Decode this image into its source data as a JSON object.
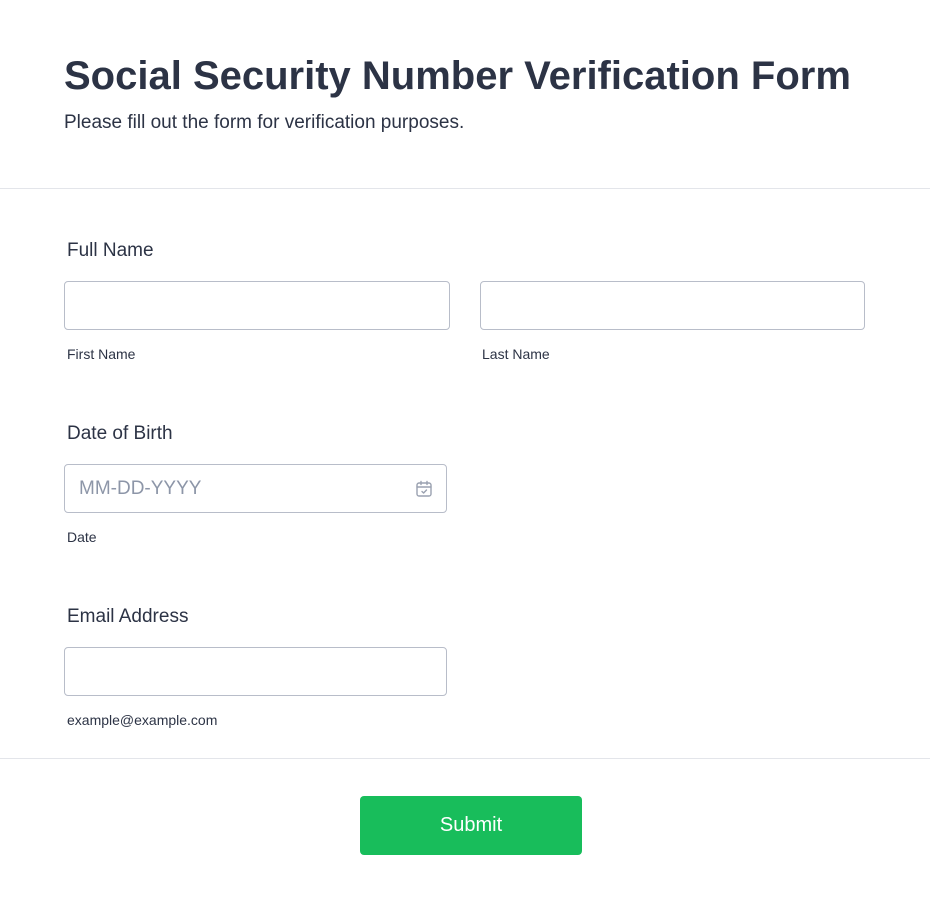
{
  "header": {
    "title": "Social Security Number Verification Form",
    "subtitle": "Please fill out the form for verification purposes."
  },
  "full_name": {
    "label": "Full Name",
    "first_name": {
      "value": "",
      "sublabel": "First Name"
    },
    "last_name": {
      "value": "",
      "sublabel": "Last Name"
    }
  },
  "date_of_birth": {
    "label": "Date of Birth",
    "value": "",
    "placeholder": "MM-DD-YYYY",
    "sublabel": "Date",
    "icon": "calendar-icon"
  },
  "email": {
    "label": "Email Address",
    "value": "",
    "sublabel": "example@example.com"
  },
  "submit": {
    "label": "Submit",
    "color": "#18bd5b"
  }
}
